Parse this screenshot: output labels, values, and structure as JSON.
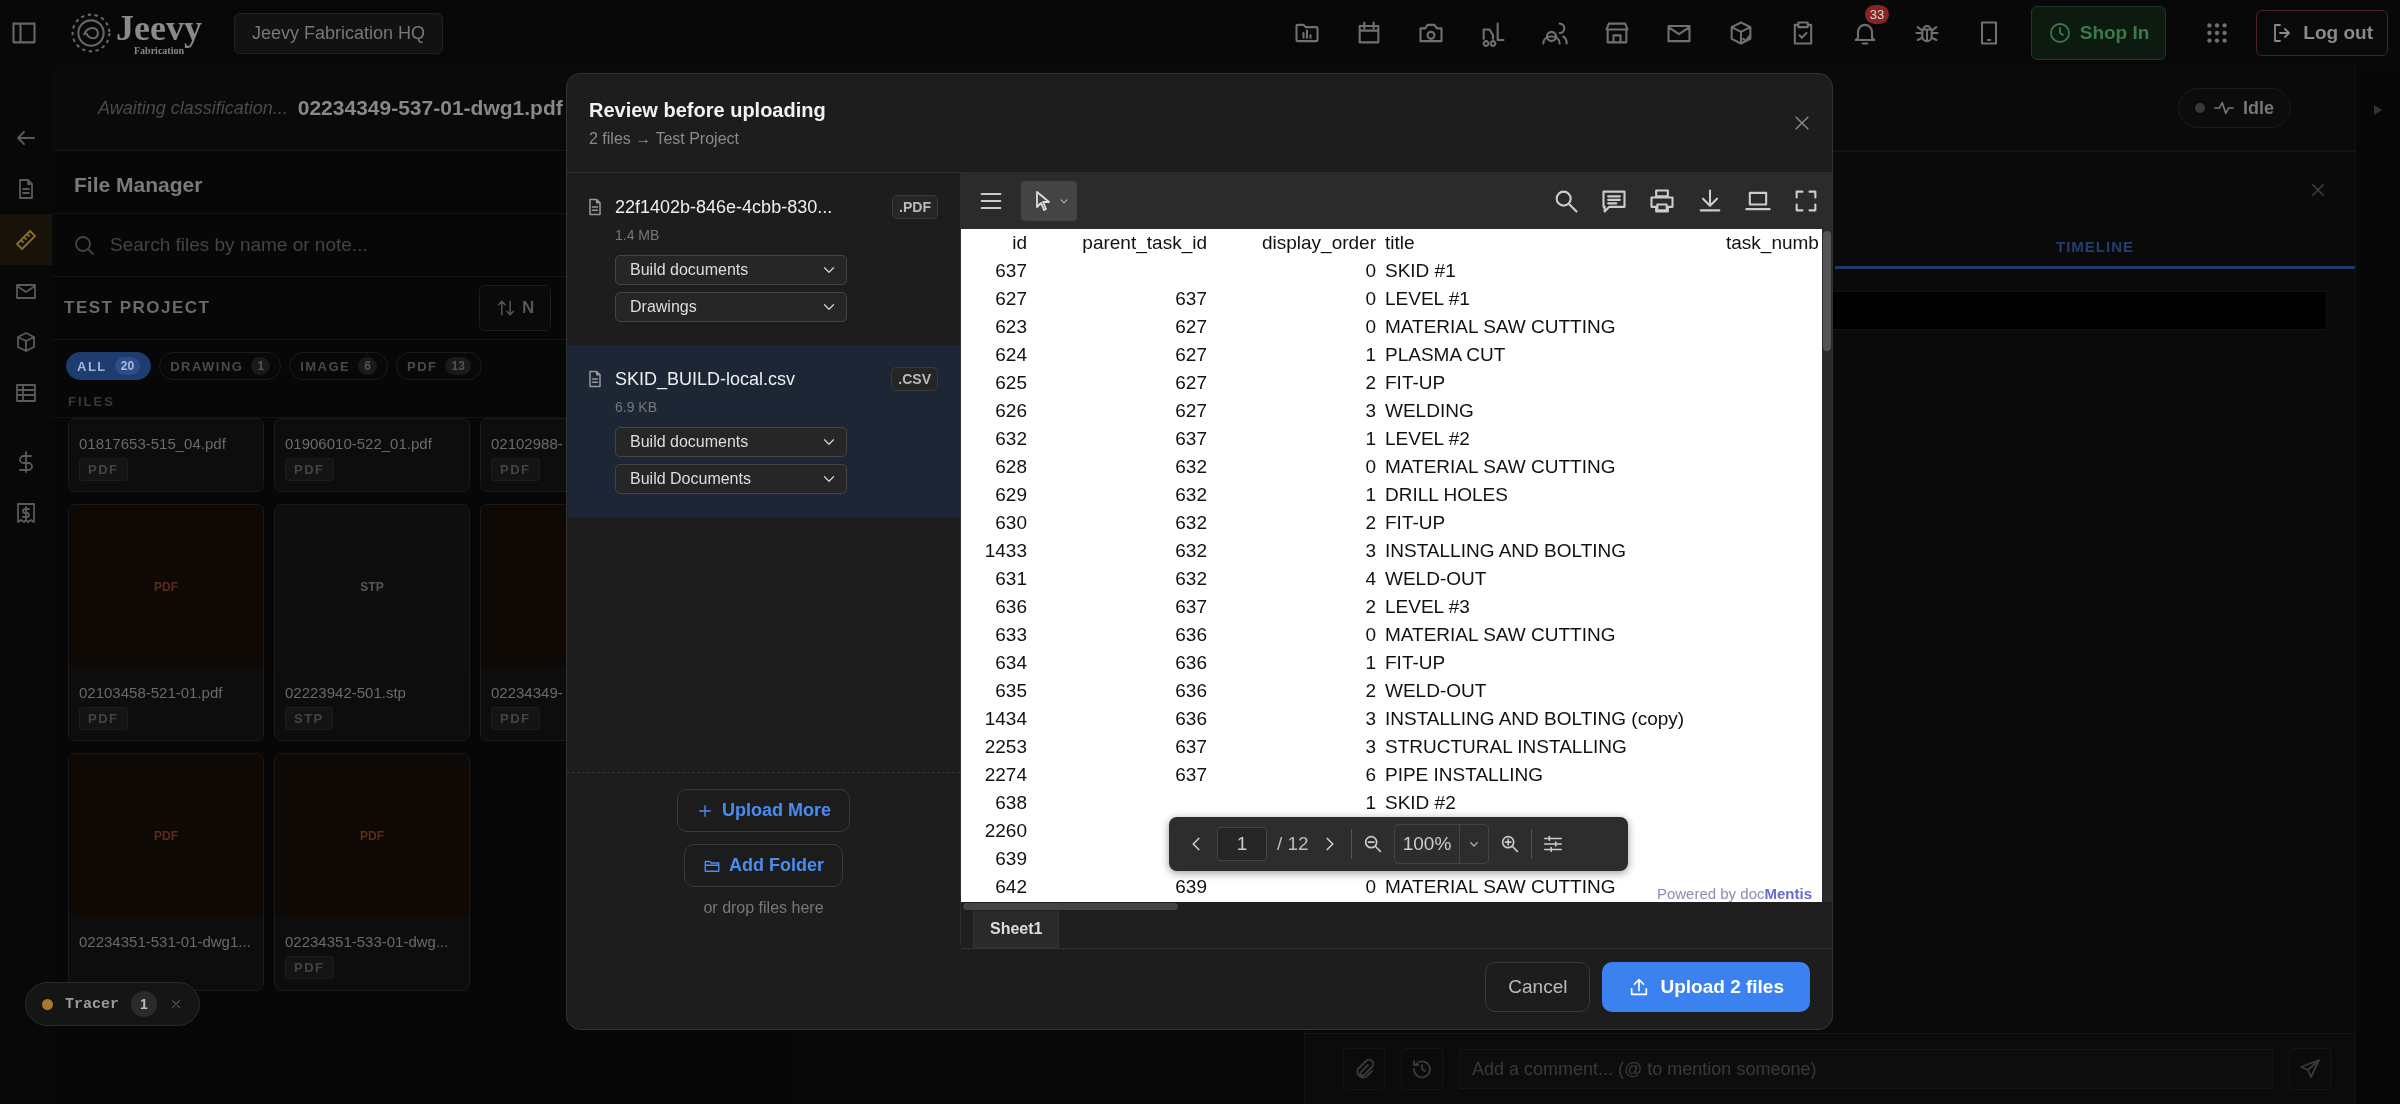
{
  "topbar": {
    "logo_name": "Jeevy",
    "logo_tagline": "Fabrication",
    "workspace": "Jeevy Fabrication HQ",
    "notification_count": "33",
    "shop_button": "Shop In",
    "logout_button": "Log out"
  },
  "rail": [
    {
      "selected": false
    },
    {
      "selected": false
    },
    {
      "selected": true
    },
    {
      "selected": false
    },
    {
      "selected": false
    },
    {
      "selected": false
    },
    {
      "selected": false
    },
    {
      "selected": false
    }
  ],
  "document_header": {
    "status": "Awaiting classification...",
    "filename": "02234349-537-01-dwg1.pdf",
    "activity": "Idle"
  },
  "file_manager": {
    "title": "File Manager",
    "search": {
      "placeholder": "Search files by name or note..."
    },
    "project": "TEST PROJECT",
    "sort_button": "N",
    "files_label": "FILES",
    "filters": [
      {
        "label": "ALL",
        "count": "20",
        "selected": true
      },
      {
        "label": "DRAWING",
        "count": "1",
        "selected": false
      },
      {
        "label": "IMAGE",
        "count": "6",
        "selected": false
      },
      {
        "label": "PDF",
        "count": "13",
        "selected": false
      }
    ],
    "files": [
      {
        "name": "01817653-515_04.pdf",
        "tag": "PDF"
      },
      {
        "name": "01906010-522_01.pdf",
        "tag": "PDF"
      },
      {
        "name": "02102988-",
        "tag": "PDF"
      },
      {
        "name": "02103458-521-01.pdf",
        "tag": "PDF",
        "thumb_label": "PDF",
        "kind": "pdf"
      },
      {
        "name": "02223942-501.stp",
        "tag": "STP",
        "thumb_label": "STP",
        "kind": "stp"
      },
      {
        "name": "02234349-",
        "tag": "PDF",
        "kind": "pdf"
      },
      {
        "name": "02234351-531-01-dwg1...",
        "thumb_label": "PDF",
        "kind": "pdf"
      },
      {
        "name": "02234351-533-01-dwg...",
        "tag": "PDF",
        "thumb_label": "PDF",
        "kind": "pdf"
      }
    ]
  },
  "detail_panel": {
    "tabs": [
      {
        "label": "TIMELINE",
        "selected": true
      }
    ],
    "comment": {
      "placeholder": "Add a comment... (@ to mention someone)"
    }
  },
  "tracer": {
    "label": "Tracer",
    "count": "1",
    "color": "#a87a2a"
  },
  "modal": {
    "title": "Review before uploading",
    "subtitle": "2 files → Test Project",
    "files": [
      {
        "name": "22f1402b-846e-4cbb-830...",
        "ext": ".PDF",
        "size": "1.4 MB",
        "selected": false,
        "category": "Build documents",
        "subcategory": "Drawings"
      },
      {
        "name": "SKID_BUILD-local.csv",
        "ext": ".CSV",
        "size": "6.9 KB",
        "selected": true,
        "category": "Build documents",
        "subcategory": "Build Documents"
      }
    ],
    "upload_more": "Upload More",
    "add_folder": "Add Folder",
    "drop_hint": "or drop files here",
    "cancel": "Cancel",
    "submit": "Upload 2 files",
    "viewer": {
      "columns": [
        "id",
        "parent_task_id",
        "display_order",
        "title",
        "task_numb"
      ],
      "rows": [
        {
          "id": "637",
          "display_order": "0",
          "title": "SKID #1"
        },
        {
          "id": "627",
          "parent_task_id": "637",
          "display_order": "0",
          "title": "LEVEL #1"
        },
        {
          "id": "623",
          "parent_task_id": "627",
          "display_order": "0",
          "title": "MATERIAL SAW CUTTING"
        },
        {
          "id": "624",
          "parent_task_id": "627",
          "display_order": "1",
          "title": "PLASMA CUT"
        },
        {
          "id": "625",
          "parent_task_id": "627",
          "display_order": "2",
          "title": "FIT-UP"
        },
        {
          "id": "626",
          "parent_task_id": "627",
          "display_order": "3",
          "title": "WELDING"
        },
        {
          "id": "632",
          "parent_task_id": "637",
          "display_order": "1",
          "title": "LEVEL #2"
        },
        {
          "id": "628",
          "parent_task_id": "632",
          "display_order": "0",
          "title": "MATERIAL SAW CUTTING"
        },
        {
          "id": "629",
          "parent_task_id": "632",
          "display_order": "1",
          "title": "DRILL HOLES"
        },
        {
          "id": "630",
          "parent_task_id": "632",
          "display_order": "2",
          "title": "FIT-UP"
        },
        {
          "id": "1433",
          "parent_task_id": "632",
          "display_order": "3",
          "title": "INSTALLING AND BOLTING"
        },
        {
          "id": "631",
          "parent_task_id": "632",
          "display_order": "4",
          "title": "WELD-OUT"
        },
        {
          "id": "636",
          "parent_task_id": "637",
          "display_order": "2",
          "title": "LEVEL #3"
        },
        {
          "id": "633",
          "parent_task_id": "636",
          "display_order": "0",
          "title": "MATERIAL SAW CUTTING"
        },
        {
          "id": "634",
          "parent_task_id": "636",
          "display_order": "1",
          "title": "FIT-UP"
        },
        {
          "id": "635",
          "parent_task_id": "636",
          "display_order": "2",
          "title": "WELD-OUT"
        },
        {
          "id": "1434",
          "parent_task_id": "636",
          "display_order": "3",
          "title": "INSTALLING AND BOLTING (copy)"
        },
        {
          "id": "2253",
          "parent_task_id": "637",
          "display_order": "3",
          "title": "STRUCTURAL INSTALLING"
        },
        {
          "id": "2274",
          "parent_task_id": "637",
          "display_order": "6",
          "title": "PIPE INSTALLING"
        },
        {
          "id": "638",
          "display_order": "1",
          "title": "SKID #2"
        },
        {
          "id": "2260"
        },
        {
          "id": "639"
        },
        {
          "id": "642",
          "parent_task_id": "639",
          "display_order": "0",
          "title": "MATERIAL SAW CUTTING"
        }
      ],
      "page": "1",
      "page_total": "/ 12",
      "zoom": "100%",
      "watermark": "Powered by doc**Mentis**",
      "sheets": [
        {
          "label": "Sheet1",
          "selected": true
        }
      ]
    }
  }
}
